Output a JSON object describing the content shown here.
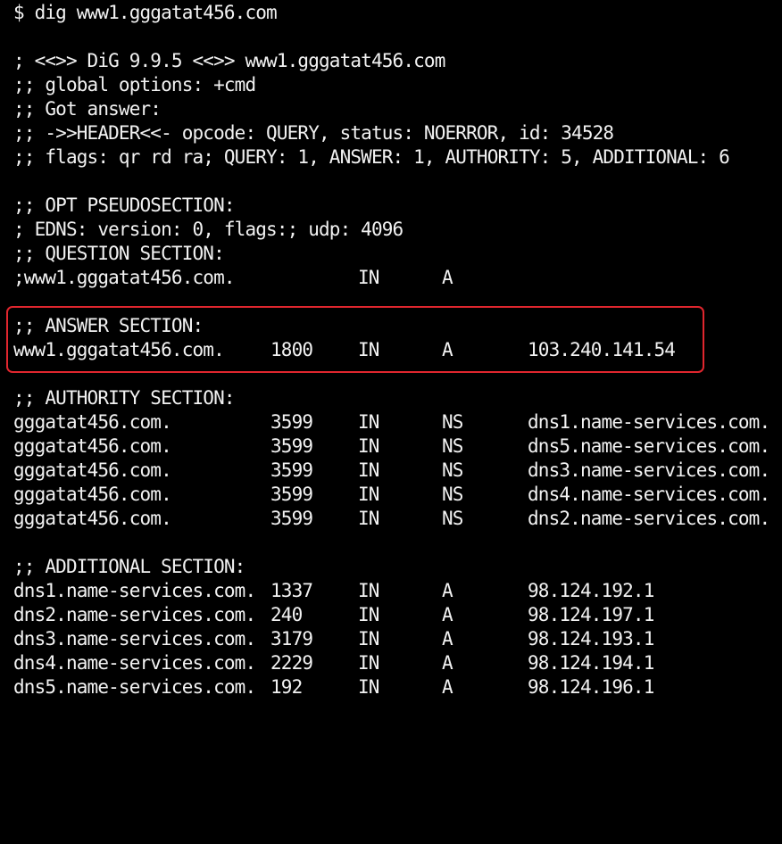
{
  "highlight_color": "#e0262e",
  "command": "$ dig www1.gggatat456.com",
  "header_lines": [
    "; <<>> DiG 9.9.5 <<>> www1.gggatat456.com",
    ";; global options: +cmd",
    ";; Got answer:",
    ";; ->>HEADER<<- opcode: QUERY, status: NOERROR, id: 34528",
    ";; flags: qr rd ra; QUERY: 1, ANSWER: 1, AUTHORITY: 5, ADDITIONAL: 6"
  ],
  "opt_section": {
    "title": ";; OPT PSEUDOSECTION:",
    "edns": "; EDNS: version: 0, flags:; udp: 4096"
  },
  "question_section": {
    "title": ";; QUESTION SECTION:",
    "name": ";www1.gggatat456.com.",
    "class": "IN",
    "type": "A"
  },
  "answer_section": {
    "title": ";; ANSWER SECTION:",
    "records": [
      {
        "name": "www1.gggatat456.com.",
        "ttl": "1800",
        "class": "IN",
        "type": "A",
        "data": "103.240.141.54"
      }
    ]
  },
  "authority_section": {
    "title": ";; AUTHORITY SECTION:",
    "records": [
      {
        "name": "gggatat456.com.",
        "ttl": "3599",
        "class": "IN",
        "type": "NS",
        "data": "dns1.name-services.com."
      },
      {
        "name": "gggatat456.com.",
        "ttl": "3599",
        "class": "IN",
        "type": "NS",
        "data": "dns5.name-services.com."
      },
      {
        "name": "gggatat456.com.",
        "ttl": "3599",
        "class": "IN",
        "type": "NS",
        "data": "dns3.name-services.com."
      },
      {
        "name": "gggatat456.com.",
        "ttl": "3599",
        "class": "IN",
        "type": "NS",
        "data": "dns4.name-services.com."
      },
      {
        "name": "gggatat456.com.",
        "ttl": "3599",
        "class": "IN",
        "type": "NS",
        "data": "dns2.name-services.com."
      }
    ]
  },
  "additional_section": {
    "title": ";; ADDITIONAL SECTION:",
    "records": [
      {
        "name": "dns1.name-services.com.",
        "ttl": "1337",
        "class": "IN",
        "type": "A",
        "data": "98.124.192.1"
      },
      {
        "name": "dns2.name-services.com.",
        "ttl": "240",
        "class": "IN",
        "type": "A",
        "data": "98.124.197.1"
      },
      {
        "name": "dns3.name-services.com.",
        "ttl": "3179",
        "class": "IN",
        "type": "A",
        "data": "98.124.193.1"
      },
      {
        "name": "dns4.name-services.com.",
        "ttl": "2229",
        "class": "IN",
        "type": "A",
        "data": "98.124.194.1"
      },
      {
        "name": "dns5.name-services.com.",
        "ttl": "192",
        "class": "IN",
        "type": "A",
        "data": "98.124.196.1"
      }
    ]
  }
}
